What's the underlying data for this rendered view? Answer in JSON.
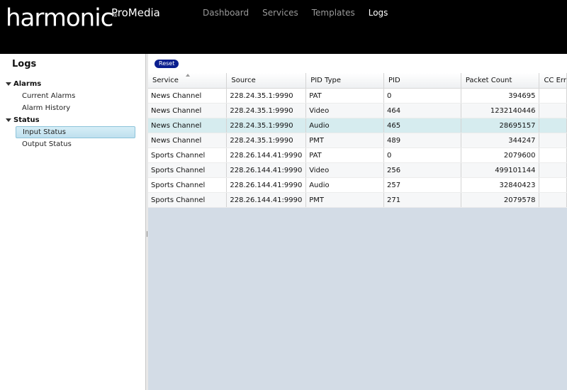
{
  "header": {
    "brand": "harmonic",
    "product": "ProMedia",
    "nav": [
      "Dashboard",
      "Services",
      "Templates",
      "Logs"
    ],
    "active_nav": "Logs"
  },
  "sidebar": {
    "title": "Logs",
    "groups": [
      {
        "label": "Alarms",
        "items": [
          "Current Alarms",
          "Alarm History"
        ]
      },
      {
        "label": "Status",
        "items": [
          "Input Status",
          "Output Status"
        ]
      }
    ],
    "selected": "Input Status"
  },
  "toolbar": {
    "reset_label": "Reset"
  },
  "table": {
    "columns": [
      "Service",
      "Source",
      "PID Type",
      "PID",
      "Packet Count",
      "CC Err"
    ],
    "sorted_column": "Service",
    "rows": [
      [
        "News Channel",
        "228.24.35.1:9990",
        "PAT",
        "0",
        "394695",
        ""
      ],
      [
        "News Channel",
        "228.24.35.1:9990",
        "Video",
        "464",
        "1232140446",
        ""
      ],
      [
        "News Channel",
        "228.24.35.1:9990",
        "Audio",
        "465",
        "28695157",
        ""
      ],
      [
        "News Channel",
        "228.24.35.1:9990",
        "PMT",
        "489",
        "344247",
        ""
      ],
      [
        "Sports Channel",
        "228.26.144.41:9990",
        "PAT",
        "0",
        "2079600",
        ""
      ],
      [
        "Sports Channel",
        "228.26.144.41:9990",
        "Video",
        "256",
        "499101144",
        ""
      ],
      [
        "Sports Channel",
        "228.26.144.41:9990",
        "Audio",
        "257",
        "32840423",
        ""
      ],
      [
        "Sports Channel",
        "228.26.144.41:9990",
        "PMT",
        "271",
        "2079578",
        ""
      ]
    ],
    "selected_row": 2
  },
  "colors": {
    "header_bg": "#000000",
    "reset_button": "#0b1f8f",
    "selected_row": "#d6ecef",
    "empty_area": "#d3dce6"
  }
}
